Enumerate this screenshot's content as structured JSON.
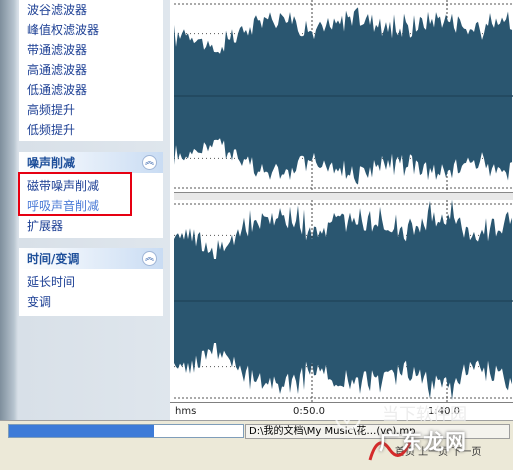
{
  "sidebar": {
    "filters": {
      "items": [
        "波谷滤波器",
        "峰值权滤波器",
        "带通滤波器",
        "高通滤波器",
        "低通滤波器",
        "高频提升",
        "低频提升"
      ]
    },
    "noise": {
      "title": "噪声削减",
      "items": [
        "磁带噪声削减",
        "呼吸声音削减",
        "扩展器"
      ]
    },
    "time": {
      "title": "时间/变调",
      "items": [
        "延长时间",
        "变调"
      ]
    },
    "collapse_glyph": "︽"
  },
  "timeline": {
    "unit": "hms",
    "mark1": "0:50.0",
    "mark2": "1:40.0"
  },
  "status": {
    "progress": 0.62,
    "path": "D:\\我的文档\\My Music\\花…(ve).mp",
    "pager": "首页  上一页  下一页"
  },
  "watermark": {
    "top": "当下软件园",
    "main": "广东龙网"
  },
  "colors": {
    "waveform": "#2a5670",
    "highlight": "#e60012",
    "link": "#1c3f94"
  }
}
